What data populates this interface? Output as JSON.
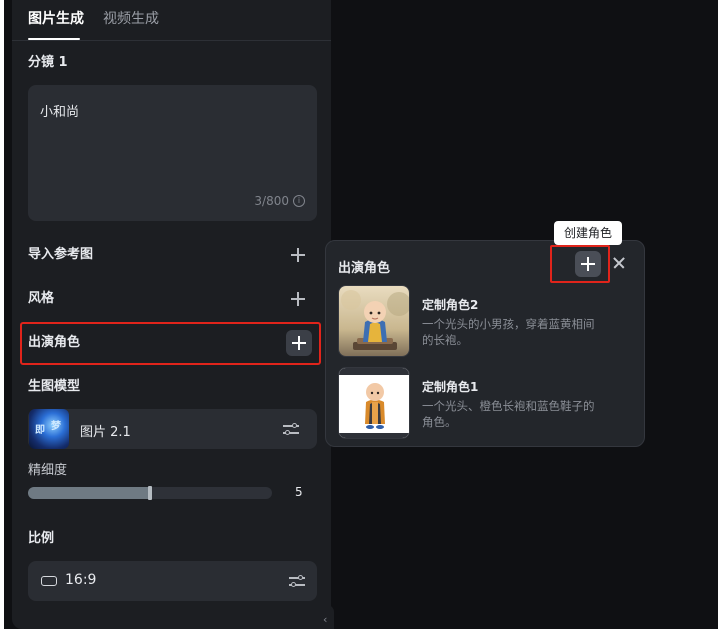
{
  "tabs": [
    {
      "label": "图片生成",
      "active": true
    },
    {
      "label": "视频生成",
      "active": false
    }
  ],
  "storyboard": {
    "label": "分镜 1",
    "prompt_text": "小和尚",
    "counter": "3/800"
  },
  "reference_image": {
    "label": "导入参考图"
  },
  "style": {
    "label": "风格"
  },
  "cast": {
    "label": "出演角色"
  },
  "model": {
    "label": "生图模型",
    "name": "图片 2.1",
    "thumb_text": [
      "即",
      "梦"
    ]
  },
  "detail": {
    "label": "精细度",
    "value": "5",
    "level_fraction": 0.5
  },
  "ratio": {
    "label": "比例",
    "value": "16:9"
  },
  "popover": {
    "title": "出演角色",
    "tooltip": "创建角色",
    "characters": [
      {
        "name": "定制角色2",
        "description": "一个光头的小男孩，穿着蓝黄相间的长袍。"
      },
      {
        "name": "定制角色1",
        "description": "一个光头、橙色长袍和蓝色鞋子的角色。"
      }
    ]
  },
  "colors": {
    "highlight": "#e0241b",
    "panel_bg": "#1c1e22",
    "canvas_bg": "#0f1013"
  }
}
